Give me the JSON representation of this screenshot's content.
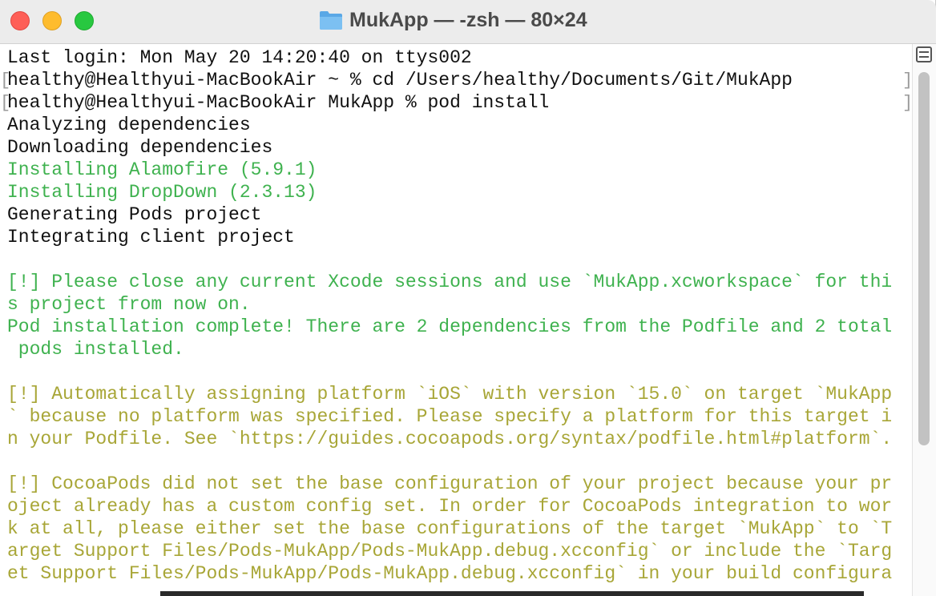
{
  "window": {
    "title": "MukApp — -zsh — 80×24",
    "title_icon": "folder-icon"
  },
  "terminal": {
    "lines": [
      {
        "text": "Last login: Mon May 20 14:20:40 on ttys002",
        "color": "default"
      },
      {
        "text": "healthy@Healthyui-MacBookAir ~ % cd /Users/healthy/Documents/Git/MukApp",
        "color": "default"
      },
      {
        "text": "healthy@Healthyui-MacBookAir MukApp % pod install",
        "color": "default"
      },
      {
        "text": "Analyzing dependencies",
        "color": "default"
      },
      {
        "text": "Downloading dependencies",
        "color": "default"
      },
      {
        "text": "Installing Alamofire (5.9.1)",
        "color": "green"
      },
      {
        "text": "Installing DropDown (2.3.13)",
        "color": "green"
      },
      {
        "text": "Generating Pods project",
        "color": "default"
      },
      {
        "text": "Integrating client project",
        "color": "default"
      },
      {
        "text": "",
        "color": "default"
      },
      {
        "text": "[!] Please close any current Xcode sessions and use `MukApp.xcworkspace` for thi",
        "color": "green"
      },
      {
        "text": "s project from now on.",
        "color": "green"
      },
      {
        "text": "Pod installation complete! There are 2 dependencies from the Podfile and 2 total",
        "color": "green"
      },
      {
        "text": " pods installed.",
        "color": "green"
      },
      {
        "text": "",
        "color": "default"
      },
      {
        "text": "[!] Automatically assigning platform `iOS` with version `15.0` on target `MukApp",
        "color": "olive"
      },
      {
        "text": "` because no platform was specified. Please specify a platform for this target i",
        "color": "olive"
      },
      {
        "text": "n your Podfile. See `https://guides.cocoapods.org/syntax/podfile.html#platform`.",
        "color": "olive"
      },
      {
        "text": "",
        "color": "default"
      },
      {
        "text": "[!] CocoaPods did not set the base configuration of your project because your pr",
        "color": "olive"
      },
      {
        "text": "oject already has a custom config set. In order for CocoaPods integration to wor",
        "color": "olive"
      },
      {
        "text": "k at all, please either set the base configurations of the target `MukApp` to `T",
        "color": "olive"
      },
      {
        "text": "arget Support Files/Pods-MukApp/Pods-MukApp.debug.xcconfig` or include the `Targ",
        "color": "olive"
      },
      {
        "text": "et Support Files/Pods-MukApp/Pods-MukApp.debug.xcconfig` in your build configura",
        "color": "olive"
      }
    ],
    "colors": {
      "default": "#111111",
      "green": "#3fb24f",
      "olive": "#a8a637"
    }
  }
}
